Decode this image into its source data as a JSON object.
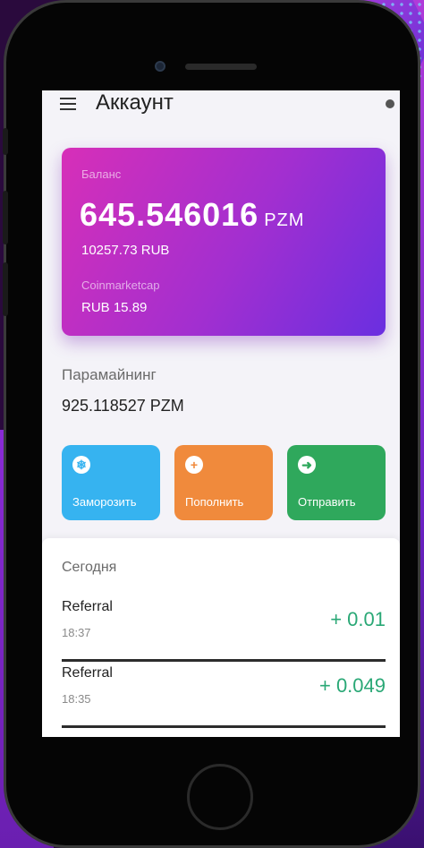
{
  "header": {
    "title": "Аккаунт"
  },
  "balance": {
    "label": "Баланс",
    "amount": "645.546016",
    "unit": "PZM",
    "rub": "10257.73 RUB",
    "cmc_label": "Coinmarketcap",
    "cmc_value": "RUB 15.89"
  },
  "paramining": {
    "label": "Парамайнинг",
    "value": "925.118527  PZM"
  },
  "actions": [
    {
      "label": "Заморозить",
      "icon": "snowflake-icon"
    },
    {
      "label": "Пополнить",
      "icon": "plus-circle-icon"
    },
    {
      "label": "Отправить",
      "icon": "send-arrow-icon"
    }
  ],
  "transactions": {
    "section": "Сегодня",
    "items": [
      {
        "title": "Referral",
        "time": "18:37",
        "amount": "+ 0.01"
      },
      {
        "title": "Referral",
        "time": "18:35",
        "amount": "+ 0.049"
      }
    ]
  },
  "colors": {
    "card_gradient": [
      "#d72fb8",
      "#6a2fe0"
    ],
    "freeze": "#36b3f0",
    "topup": "#f08a3c",
    "send": "#2fa85c",
    "positive_amount": "#2aa876"
  }
}
